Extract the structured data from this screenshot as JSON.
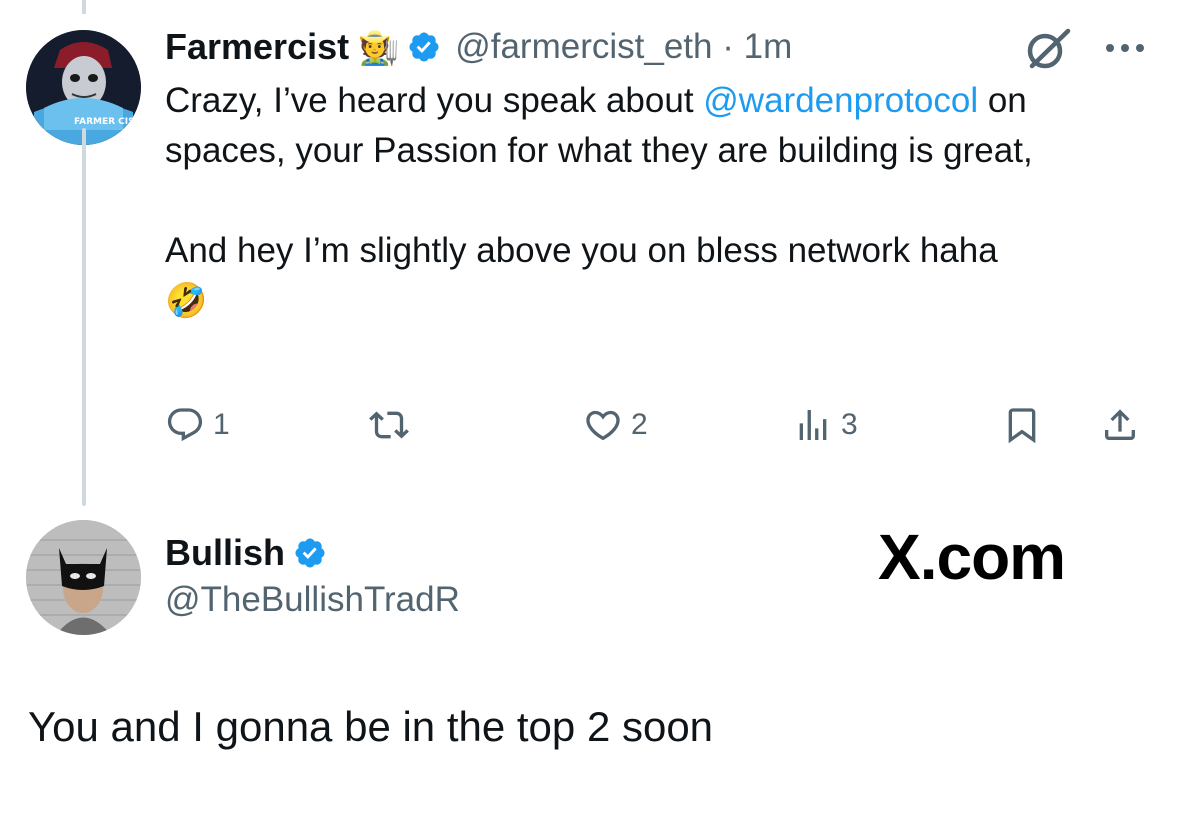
{
  "tweet": {
    "author": {
      "display_name": "Farmercist",
      "name_emoji": "🧑‍🌾",
      "handle": "@farmercist_eth",
      "time": "· 1m",
      "avatar_icon": "farmercist-avatar",
      "avatar_text": "FARMER CIST"
    },
    "text": {
      "line1_prefix": "Crazy, I’ve heard you speak about ",
      "mention": "@wardenprotocol",
      "line1_suffix": " on spaces, your Passion for what they are building is great,",
      "line2": "And hey I’m slightly above you on bless network haha",
      "emoji": "🤣"
    },
    "actions": {
      "replies": "1",
      "reposts": "",
      "likes": "2",
      "views": "3"
    }
  },
  "reply": {
    "author": {
      "display_name": "Bullish",
      "handle": "@TheBullishTradR",
      "avatar_icon": "bullish-avatar"
    },
    "text": "You and I gonna be in the top 2 soon"
  },
  "watermark": "X.com",
  "colors": {
    "link": "#1d9bf0",
    "secondary_text": "#536471",
    "thread_line": "#cfd9de",
    "verified": "#1d9bf0"
  }
}
